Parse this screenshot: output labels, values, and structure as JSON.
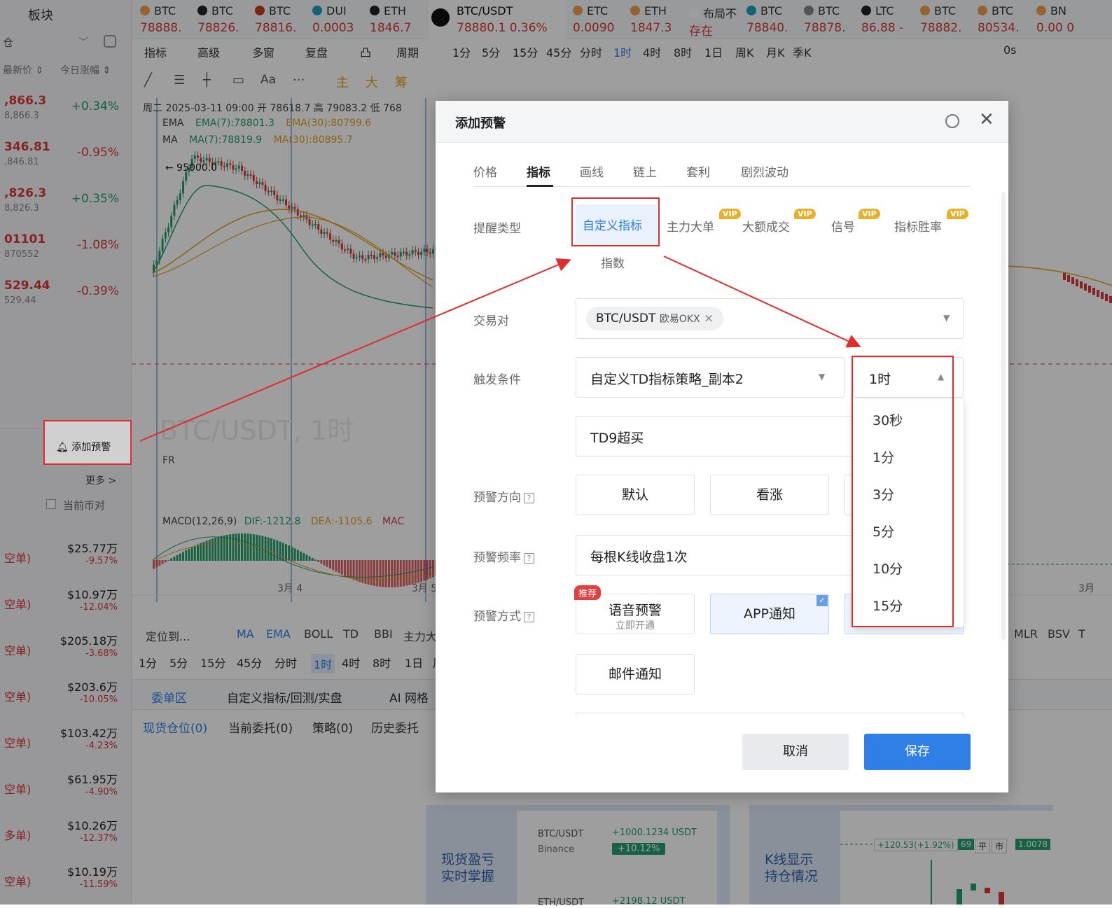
{
  "left_panel": {
    "title": "板块",
    "sub_left": "仓",
    "col_price": "最新价 ⇕",
    "col_change": "今日涨幅 ⇕",
    "rows": [
      {
        "price": ",866.3",
        "sub": "8,866.3",
        "pct": "+0.34%",
        "up": true
      },
      {
        "price": "346.81",
        "sub": ",846.81",
        "pct": "-0.95%",
        "up": false
      },
      {
        "price": ",826.3",
        "sub": "8,826.3",
        "pct": "+0.35%",
        "up": true
      },
      {
        "price": "01101",
        "sub": "870552",
        "pct": "-1.08%",
        "up": false
      },
      {
        "price": "529.44",
        "sub": "529.44",
        "pct": "-0.39%",
        "up": false
      }
    ],
    "add_alert": "添加预警",
    "more": "更多 >",
    "current_pair": "当前币对",
    "positions": [
      {
        "tag": "空单)",
        "amt": "$25.77万",
        "pct": "-9.57%"
      },
      {
        "tag": "空单)",
        "amt": "$10.97万",
        "pct": "-12.04%"
      },
      {
        "tag": "空单)",
        "amt": "$205.18万",
        "pct": "-3.68%"
      },
      {
        "tag": "空单)",
        "amt": "$203.6万",
        "pct": "-10.05%"
      },
      {
        "tag": "空单)",
        "amt": "$103.42万",
        "pct": "-4.23%"
      },
      {
        "tag": "空单)",
        "amt": "$61.95万",
        "pct": "-4.90%"
      },
      {
        "tag": "多单)",
        "amt": "$10.26万",
        "pct": "-12.37%"
      },
      {
        "tag": "空单)",
        "amt": "$10.19万",
        "pct": "-11.59%"
      }
    ]
  },
  "ticker": [
    {
      "name": "BTC",
      "price": "78888.",
      "color": "#f0a050"
    },
    {
      "name": "BTC",
      "price": "78826.",
      "color": "#222222"
    },
    {
      "name": "BTC",
      "price": "78816.",
      "color": "#c04020"
    },
    {
      "name": "DUI",
      "price": "0.0003",
      "color": "#20a0c0"
    },
    {
      "name": "ETH",
      "price": "1846.7",
      "color": "#222222"
    },
    {
      "name": "BTC/USDT",
      "price": "78880.1 0.36%",
      "color": "#111111"
    },
    {
      "name": "ETC",
      "price": "0.0090",
      "color": "#f0a050"
    },
    {
      "name": "ETH",
      "price": "1847.3",
      "color": "#f0a050"
    },
    {
      "name": "布局不",
      "price": "存在",
      "color": "#ffffff"
    },
    {
      "name": "BTC",
      "price": "78840.",
      "color": "#20a0c0"
    },
    {
      "name": "BTC",
      "price": "78878.",
      "color": "#888888"
    },
    {
      "name": "LTC",
      "price": "86.88 -",
      "color": "#222222"
    },
    {
      "name": "BTC",
      "price": "78882.",
      "color": "#f0a050"
    },
    {
      "name": "BTC",
      "price": "80534.",
      "color": "#f0a050"
    },
    {
      "name": "BN",
      "price": "0.00 0",
      "color": "#f0a050"
    }
  ],
  "toolbar": {
    "items": [
      "指标",
      "高级",
      "多窗",
      "复盘",
      "凸",
      "周期",
      "1分",
      "5分",
      "15分",
      "45分",
      "分时",
      "1时",
      "4时",
      "8时",
      "1日",
      "周K",
      "月K",
      "季K"
    ],
    "right": "0s"
  },
  "drawing_tools": [
    "主",
    "大",
    "筹"
  ],
  "chart": {
    "info_line": "周二 2025-03-11 09:00  开 78618.7  高 79083.2  低 768",
    "ema_label": "EMA",
    "ema7": "EMA(7):78801.3",
    "ema30": "EMA(30):80799.6",
    "ma_label": "MA",
    "ma7": "MA(7):78819.9",
    "ma30": "MA(30):80895.7",
    "high_marker": "← 95000.0",
    "watermark": "BTC/USDT, 1时",
    "fr": "FR",
    "macd": "MACD(12,26,9)",
    "dif": "DIF:-1212.8",
    "dea": "DEA:-1105.6",
    "mac": "MAC",
    "date1": "3月 4",
    "date2": "3月 5",
    "date3": "3月"
  },
  "bottom": {
    "toolbar_a": [
      "定位到...",
      "MA",
      "EMA",
      "BOLL",
      "TD",
      "BBI",
      "主力大"
    ],
    "periods": [
      "1分",
      "5分",
      "15分",
      "45分",
      "分时",
      "1时",
      "4时",
      "8时",
      "1日",
      "周"
    ],
    "right_tools": [
      "MLR",
      "BSV",
      "T"
    ],
    "tabs": [
      "委单区",
      "自定义指标/回测/实盘",
      "AI 网格"
    ],
    "subtabs": [
      "现货仓位(0)",
      "当前委托(0)",
      "策略(0)",
      "历史委托"
    ],
    "promo1": "现货盈亏\n实时掌握",
    "promo1_pair": "BTC/USDT",
    "promo1_ex": "Binance",
    "promo1_val": "+1000.1234 USDT",
    "promo1_pct": "+10.12%",
    "promo1_pair2": "ETH/USDT",
    "promo1_val2": "+2198.12 USDT",
    "promo2": "K线显示\n持仓情况",
    "promo2_val": "+120.53(+1.92%)",
    "promo2_n": "69",
    "promo2_a": "平",
    "promo2_b": "市",
    "promo2_c": "1.0078"
  },
  "dialog": {
    "title": "添加预警",
    "tabs": [
      "价格",
      "指标",
      "画线",
      "链上",
      "套利",
      "剧烈波动"
    ],
    "active_tab": "指标",
    "alert_type_label": "提醒类型",
    "alert_types": [
      "自定义指标",
      "主力大单",
      "大额成交",
      "信号",
      "指标胜率"
    ],
    "vip": "VIP",
    "index": "指数",
    "pair_label": "交易对",
    "pair_value": "BTC/USDT",
    "pair_ex": "欧易OKX",
    "trigger_label": "触发条件",
    "trigger_value": "自定义TD指标策略_副本2",
    "period_value": "1时",
    "condition_value": "TD9超买",
    "direction_label": "预警方向",
    "directions": [
      "默认",
      "看涨"
    ],
    "freq_label": "预警频率",
    "freq_value": "每根K线收盘1次",
    "method_label": "预警方式",
    "recommend": "推荐",
    "voice": "语音预警",
    "voice_sub": "立即开通",
    "app": "APP通知",
    "email": "邮件通知",
    "cancel": "取消",
    "save": "保存",
    "period_options": [
      "30秒",
      "1分",
      "3分",
      "5分",
      "10分",
      "15分"
    ]
  },
  "colors": {
    "accent": "#2f7fe6",
    "up": "#22a06b",
    "down": "#d83a3a",
    "annotation": "#e02c2c"
  }
}
